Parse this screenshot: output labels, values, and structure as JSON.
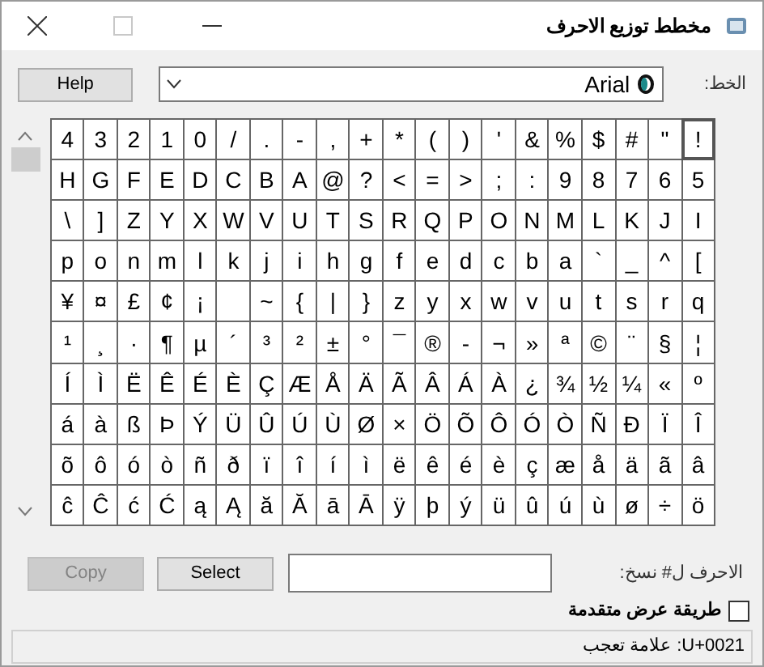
{
  "window": {
    "title": "مخطط توزيع الاحرف"
  },
  "font": {
    "label": "الخط:",
    "value": "Arial"
  },
  "help_button": "Help",
  "characters": [
    [
      {
        "char": "!",
        "selected": true
      },
      {
        "char": "\"",
        "selected": false
      },
      {
        "char": "#",
        "selected": false
      },
      {
        "char": "$",
        "selected": false
      },
      {
        "char": "%",
        "selected": false
      },
      {
        "char": "&",
        "selected": false
      },
      {
        "char": "'",
        "selected": false
      },
      {
        "char": "(",
        "selected": false
      },
      {
        "char": ")",
        "selected": false
      },
      {
        "char": "*",
        "selected": false
      },
      {
        "char": "+",
        "selected": false
      },
      {
        "char": ",",
        "selected": false
      },
      {
        "char": "-",
        "selected": false
      },
      {
        "char": ".",
        "selected": false
      },
      {
        "char": "/",
        "selected": false
      },
      {
        "char": "0",
        "selected": false
      },
      {
        "char": "1",
        "selected": false
      },
      {
        "char": "2",
        "selected": false
      },
      {
        "char": "3",
        "selected": false
      },
      {
        "char": "4",
        "selected": false
      }
    ],
    [
      {
        "char": "5",
        "selected": false
      },
      {
        "char": "6",
        "selected": false
      },
      {
        "char": "7",
        "selected": false
      },
      {
        "char": "8",
        "selected": false
      },
      {
        "char": "9",
        "selected": false
      },
      {
        "char": ":",
        "selected": false
      },
      {
        "char": ";",
        "selected": false
      },
      {
        "char": "<",
        "selected": false
      },
      {
        "char": "=",
        "selected": false
      },
      {
        "char": ">",
        "selected": false
      },
      {
        "char": "?",
        "selected": false
      },
      {
        "char": "@",
        "selected": false
      },
      {
        "char": "A",
        "selected": false
      },
      {
        "char": "B",
        "selected": false
      },
      {
        "char": "C",
        "selected": false
      },
      {
        "char": "D",
        "selected": false
      },
      {
        "char": "E",
        "selected": false
      },
      {
        "char": "F",
        "selected": false
      },
      {
        "char": "G",
        "selected": false
      },
      {
        "char": "H",
        "selected": false
      }
    ],
    [
      {
        "char": "I",
        "selected": false
      },
      {
        "char": "J",
        "selected": false
      },
      {
        "char": "K",
        "selected": false
      },
      {
        "char": "L",
        "selected": false
      },
      {
        "char": "M",
        "selected": false
      },
      {
        "char": "N",
        "selected": false
      },
      {
        "char": "O",
        "selected": false
      },
      {
        "char": "P",
        "selected": false
      },
      {
        "char": "Q",
        "selected": false
      },
      {
        "char": "R",
        "selected": false
      },
      {
        "char": "S",
        "selected": false
      },
      {
        "char": "T",
        "selected": false
      },
      {
        "char": "U",
        "selected": false
      },
      {
        "char": "V",
        "selected": false
      },
      {
        "char": "W",
        "selected": false
      },
      {
        "char": "X",
        "selected": false
      },
      {
        "char": "Y",
        "selected": false
      },
      {
        "char": "Z",
        "selected": false
      },
      {
        "char": "[",
        "selected": false
      },
      {
        "char": "\\",
        "selected": false
      }
    ],
    [
      {
        "char": "]",
        "selected": false
      },
      {
        "char": "^",
        "selected": false
      },
      {
        "char": "_",
        "selected": false
      },
      {
        "char": "`",
        "selected": false
      },
      {
        "char": "a",
        "selected": false
      },
      {
        "char": "b",
        "selected": false
      },
      {
        "char": "c",
        "selected": false
      },
      {
        "char": "d",
        "selected": false
      },
      {
        "char": "e",
        "selected": false
      },
      {
        "char": "f",
        "selected": false
      },
      {
        "char": "g",
        "selected": false
      },
      {
        "char": "h",
        "selected": false
      },
      {
        "char": "i",
        "selected": false
      },
      {
        "char": "j",
        "selected": false
      },
      {
        "char": "k",
        "selected": false
      },
      {
        "char": "l",
        "selected": false
      },
      {
        "char": "m",
        "selected": false
      },
      {
        "char": "n",
        "selected": false
      },
      {
        "char": "o",
        "selected": false
      },
      {
        "char": "p",
        "selected": false
      }
    ],
    [
      {
        "char": "q",
        "selected": false
      },
      {
        "char": "r",
        "selected": false
      },
      {
        "char": "s",
        "selected": false
      },
      {
        "char": "t",
        "selected": false
      },
      {
        "char": "u",
        "selected": false
      },
      {
        "char": "v",
        "selected": false
      },
      {
        "char": "w",
        "selected": false
      },
      {
        "char": "x",
        "selected": false
      },
      {
        "char": "y",
        "selected": false
      },
      {
        "char": "z",
        "selected": false
      },
      {
        "char": "{",
        "selected": false
      },
      {
        "char": "|",
        "selected": false
      },
      {
        "char": "}",
        "selected": false
      },
      {
        "char": "~",
        "selected": false
      },
      {
        "selected": false
      },
      {
        "char": "¡",
        "selected": false
      },
      {
        "char": "¢",
        "selected": false
      },
      {
        "char": "£",
        "selected": false
      },
      {
        "char": "¤",
        "selected": false
      },
      {
        "char": "¥",
        "selected": false
      }
    ],
    [
      {
        "char": "¦",
        "selected": false
      },
      {
        "char": "§",
        "selected": false
      },
      {
        "char": "¨",
        "selected": false
      },
      {
        "char": "©",
        "selected": false
      },
      {
        "char": "ª",
        "selected": false
      },
      {
        "char": "«",
        "selected": false
      },
      {
        "char": "¬",
        "selected": false
      },
      {
        "char": "-",
        "selected": false
      },
      {
        "char": "®",
        "selected": false
      },
      {
        "char": "¯",
        "selected": false
      },
      {
        "char": "°",
        "selected": false
      },
      {
        "char": "±",
        "selected": false
      },
      {
        "char": "²",
        "selected": false
      },
      {
        "char": "³",
        "selected": false
      },
      {
        "char": "´",
        "selected": false
      },
      {
        "char": "µ",
        "selected": false
      },
      {
        "char": "¶",
        "selected": false
      },
      {
        "char": "·",
        "selected": false
      },
      {
        "char": "¸",
        "selected": false
      },
      {
        "char": "¹",
        "selected": false
      }
    ],
    [
      {
        "char": "º",
        "selected": false
      },
      {
        "char": "»",
        "selected": false
      },
      {
        "char": "¼",
        "selected": false
      },
      {
        "char": "½",
        "selected": false
      },
      {
        "char": "¾",
        "selected": false
      },
      {
        "char": "¿",
        "selected": false
      },
      {
        "char": "À",
        "selected": false
      },
      {
        "char": "Á",
        "selected": false
      },
      {
        "char": "Â",
        "selected": false
      },
      {
        "char": "Ã",
        "selected": false
      },
      {
        "char": "Ä",
        "selected": false
      },
      {
        "char": "Å",
        "selected": false
      },
      {
        "char": "Æ",
        "selected": false
      },
      {
        "char": "Ç",
        "selected": false
      },
      {
        "char": "È",
        "selected": false
      },
      {
        "char": "É",
        "selected": false
      },
      {
        "char": "Ê",
        "selected": false
      },
      {
        "char": "Ë",
        "selected": false
      },
      {
        "char": "Ì",
        "selected": false
      },
      {
        "char": "Í",
        "selected": false
      }
    ],
    [
      {
        "char": "Î",
        "selected": false
      },
      {
        "char": "Ï",
        "selected": false
      },
      {
        "char": "Ð",
        "selected": false
      },
      {
        "char": "Ñ",
        "selected": false
      },
      {
        "char": "Ò",
        "selected": false
      },
      {
        "char": "Ó",
        "selected": false
      },
      {
        "char": "Ô",
        "selected": false
      },
      {
        "char": "Õ",
        "selected": false
      },
      {
        "char": "Ö",
        "selected": false
      },
      {
        "char": "×",
        "selected": false
      },
      {
        "char": "Ø",
        "selected": false
      },
      {
        "char": "Ù",
        "selected": false
      },
      {
        "char": "Ú",
        "selected": false
      },
      {
        "char": "Û",
        "selected": false
      },
      {
        "char": "Ü",
        "selected": false
      },
      {
        "char": "Ý",
        "selected": false
      },
      {
        "char": "Þ",
        "selected": false
      },
      {
        "char": "ß",
        "selected": false
      },
      {
        "char": "à",
        "selected": false
      },
      {
        "char": "á",
        "selected": false
      }
    ],
    [
      {
        "char": "â",
        "selected": false
      },
      {
        "char": "ã",
        "selected": false
      },
      {
        "char": "ä",
        "selected": false
      },
      {
        "char": "å",
        "selected": false
      },
      {
        "char": "æ",
        "selected": false
      },
      {
        "char": "ç",
        "selected": false
      },
      {
        "char": "è",
        "selected": false
      },
      {
        "char": "é",
        "selected": false
      },
      {
        "char": "ê",
        "selected": false
      },
      {
        "char": "ë",
        "selected": false
      },
      {
        "char": "ì",
        "selected": false
      },
      {
        "char": "í",
        "selected": false
      },
      {
        "char": "î",
        "selected": false
      },
      {
        "char": "ï",
        "selected": false
      },
      {
        "char": "ð",
        "selected": false
      },
      {
        "char": "ñ",
        "selected": false
      },
      {
        "char": "ò",
        "selected": false
      },
      {
        "char": "ó",
        "selected": false
      },
      {
        "char": "ô",
        "selected": false
      },
      {
        "char": "õ",
        "selected": false
      }
    ],
    [
      {
        "char": "ö",
        "selected": false
      },
      {
        "char": "÷",
        "selected": false
      },
      {
        "char": "ø",
        "selected": false
      },
      {
        "char": "ù",
        "selected": false
      },
      {
        "char": "ú",
        "selected": false
      },
      {
        "char": "û",
        "selected": false
      },
      {
        "char": "ü",
        "selected": false
      },
      {
        "char": "ý",
        "selected": false
      },
      {
        "char": "þ",
        "selected": false
      },
      {
        "char": "ÿ",
        "selected": false
      },
      {
        "char": "Ā",
        "selected": false
      },
      {
        "char": "ā",
        "selected": false
      },
      {
        "char": "Ă",
        "selected": false
      },
      {
        "char": "ă",
        "selected": false
      },
      {
        "char": "Ą",
        "selected": false
      },
      {
        "char": "ą",
        "selected": false
      },
      {
        "char": "Ć",
        "selected": false
      },
      {
        "char": "ć",
        "selected": false
      },
      {
        "char": "Ĉ",
        "selected": false
      },
      {
        "char": "ĉ",
        "selected": false
      }
    ]
  ],
  "copy_field": {
    "label": "الاحرف ل# نسخ:"
  },
  "select_button": "Select",
  "copy_button": {
    "label": "Copy",
    "disabled": true
  },
  "advanced_view": {
    "label": "طريقة عرض متقدمة",
    "checked": false
  },
  "status_bar": "U+0021: علامة تعجب"
}
